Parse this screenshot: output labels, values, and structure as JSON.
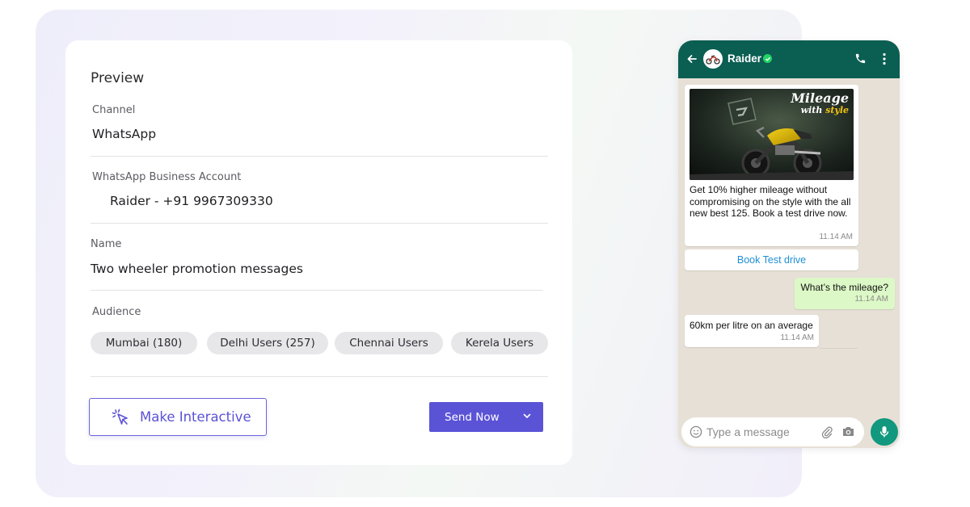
{
  "preview": {
    "title": "Preview",
    "channel_label": "Channel",
    "channel_value": "WhatsApp",
    "account_label": "WhatsApp Business Account",
    "account_value": "Raider - +91 9967309330",
    "name_label": "Name",
    "name_value": "Two wheeler promotion messages",
    "audience_label": "Audience",
    "audience_chips": [
      "Mumbai (180)",
      "Delhi Users (257)",
      "Chennai Users",
      "Kerela Users"
    ]
  },
  "actions": {
    "interactive_label": "Make Interactive",
    "send_label": "Send Now"
  },
  "phone": {
    "contact_name": "Raider",
    "banner_line1": "Mileage",
    "banner_line2a": "with ",
    "banner_line2b": "style",
    "promo_text": "Get 10% higher mileage without compromising on the style with the all new best 125. Book a test drive now.",
    "promo_time": "11.14 AM",
    "cta_label": "Book Test drive",
    "out_text": "What’s the mileage?",
    "out_time": "11.14 AM",
    "reply_text": "60km per litre on an average",
    "reply_time": "11.14 AM",
    "input_placeholder": "Type a message"
  },
  "colors": {
    "accent": "#5b53d6",
    "whatsapp_header": "#0b5e52",
    "whatsapp_mic": "#11987f",
    "chat_bg": "#e6e0d6",
    "out_bubble": "#dcf8c6",
    "link_blue": "#1e8fd6"
  }
}
